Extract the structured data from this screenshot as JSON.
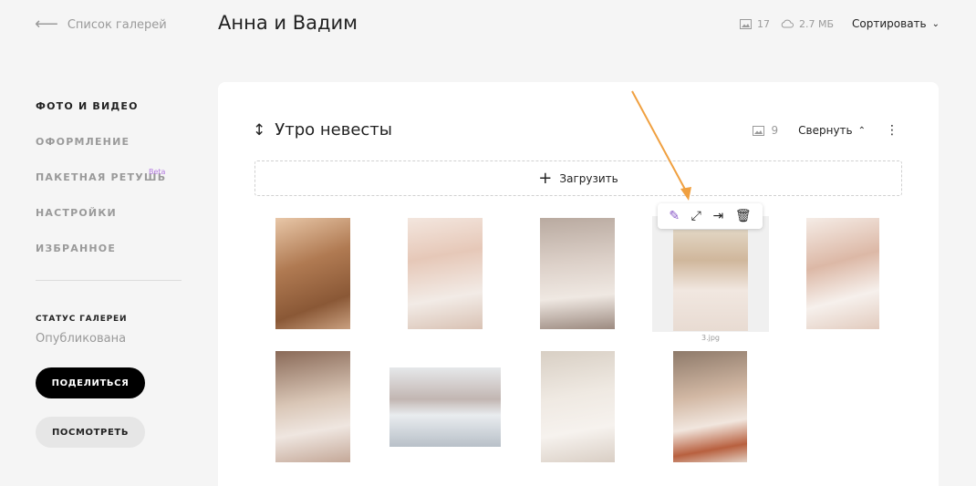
{
  "header": {
    "back_label": "Список галерей",
    "title": "Анна и Вадим",
    "photo_count": "17",
    "storage": "2.7 МБ",
    "sort_label": "Сортировать"
  },
  "sidebar": {
    "items": [
      {
        "label": "ФОТО И ВИДЕО",
        "active": true
      },
      {
        "label": "ОФОРМЛЕНИЕ",
        "active": false
      },
      {
        "label": "ПАКЕТНАЯ РЕТУШЬ",
        "active": false,
        "badge": "Beta"
      },
      {
        "label": "НАСТРОЙКИ",
        "active": false
      },
      {
        "label": "ИЗБРАННОЕ",
        "active": false
      }
    ],
    "status_label": "СТАТУС ГАЛЕРЕИ",
    "status_value": "Опубликована",
    "share_button": "ПОДЕЛИТЬСЯ",
    "view_button": "ПОСМОТРЕТЬ"
  },
  "section": {
    "title": "Утро невесты",
    "count": "9",
    "collapse_label": "Свернуть",
    "upload_label": "Загрузить"
  },
  "selected_photo": {
    "filename": "3.jpg"
  },
  "colors": {
    "accent_arrow": "#f0a040",
    "beta_badge": "#b47be0"
  }
}
